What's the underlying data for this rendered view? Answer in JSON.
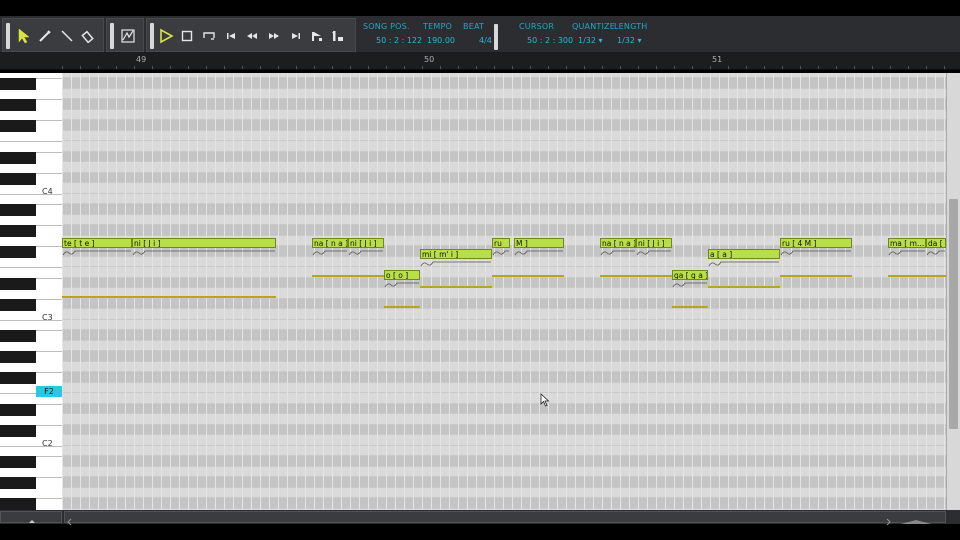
{
  "toolbar": {
    "tools": [
      {
        "name": "select-tool-icon",
        "active": true
      },
      {
        "name": "pencil-tool-icon",
        "active": false
      },
      {
        "name": "line-tool-icon",
        "active": false
      },
      {
        "name": "eraser-tool-icon",
        "active": false
      }
    ],
    "transport": [
      "play-icon",
      "stop-icon",
      "loop-icon",
      "go-to-start-icon",
      "rewind-icon",
      "fast-forward-icon",
      "go-to-end-icon",
      "auto-scroll-icon",
      "sync-icon"
    ],
    "song_pos_label": "SONG POS.",
    "song_pos_value": "50 : 2 : 122",
    "tempo_label": "TEMPO",
    "tempo_value": "190.00",
    "beat_label": "BEAT",
    "beat_value": "4/4",
    "cursor_label": "CURSOR",
    "cursor_value": "50 : 2 : 300",
    "quantize_label": "QUANTIZE",
    "quantize_value": "1/32 ▾",
    "length_label": "LENGTH",
    "length_value": "1/32 ▾"
  },
  "ruler": {
    "marks": [
      "49",
      "50",
      "51"
    ]
  },
  "keyboard": {
    "labels": [
      "C4",
      "C3",
      "C2"
    ],
    "highlighted": "F2"
  },
  "notes": [
    {
      "lyric": "te [ t e ]",
      "row": 0
    },
    {
      "lyric": "ni [ J i ]",
      "row": 0
    },
    {
      "lyric": "na [ n a ]",
      "row": 0
    },
    {
      "lyric": "ni [ J i ]",
      "row": 0
    },
    {
      "lyric": "o [ o ]",
      "row": 3
    },
    {
      "lyric": "mi [ m' i ]",
      "row": 1
    },
    {
      "lyric": "ru",
      "row": 0
    },
    {
      "lyric": "M ]",
      "row": 0
    },
    {
      "lyric": "na [ n a ]",
      "row": 0
    },
    {
      "lyric": "ni [ J i ]",
      "row": 0
    },
    {
      "lyric": "ga [ g a ]",
      "row": 3
    },
    {
      "lyric": "a [ a ]",
      "row": 1
    },
    {
      "lyric": "ru [ 4 M ]",
      "row": 0
    },
    {
      "lyric": "ma [ m…",
      "row": 0
    },
    {
      "lyric": "da [ d…",
      "row": 0
    }
  ],
  "colors": {
    "note_fill": "#b8df47",
    "velocity_bar": "#b7a51f",
    "accent": "#2ab7d6",
    "key_highlight": "#27c9e0"
  }
}
